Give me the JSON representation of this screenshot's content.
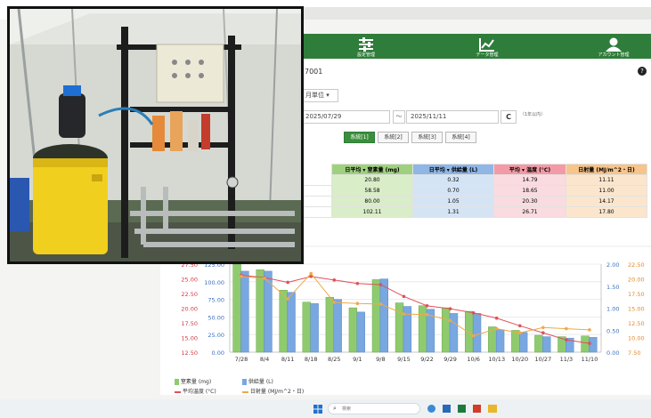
{
  "nav": {
    "items": [
      {
        "label": "設定管理",
        "icon": "sliders-icon"
      },
      {
        "label": "データ管理",
        "icon": "chart-icon"
      },
      {
        "label": "アカウント管理",
        "icon": "user-icon"
      }
    ]
  },
  "page": {
    "device_id": "7001",
    "help": "?",
    "dropdown_value": "月単位 ▾",
    "date_from": "2025/07/29",
    "date_sep": "～",
    "date_to": "2025/11/11",
    "refresh": "C",
    "note": "（1年以内）"
  },
  "tabs": [
    "系統[1]",
    "系統[2]",
    "系統[3]",
    "系統[4]"
  ],
  "table": {
    "headers": [
      "日平均 ▾ 窒素量 (mg)",
      "日平均 ▾ 供給量 (L)",
      "平均 ▾ 温度 (°C)",
      "日射量 (MJ/m^2・日)"
    ],
    "header_colors": [
      "#9fd07e",
      "#8eb6e6",
      "#f39aa6",
      "#f7c48a"
    ],
    "cell_colors": [
      "#d9edc8",
      "#d5e4f5",
      "#f9dbe0",
      "#fbe6cd"
    ],
    "rows": [
      [
        "20.80",
        "0.32",
        "14.79",
        "11.11"
      ],
      [
        "58.58",
        "0.70",
        "18.65",
        "11.00"
      ],
      [
        "80.00",
        "1.05",
        "20.30",
        "14.17"
      ],
      [
        "102.11",
        "1.31",
        "26.71",
        "17.80"
      ]
    ]
  },
  "legend": [
    {
      "label": "窒素量 (mg)",
      "color": "#8fcb6e"
    },
    {
      "label": "供給量 (L)",
      "color": "#79a7e0"
    },
    {
      "label": "平均温度 (°C)",
      "color": "#e0505a"
    },
    {
      "label": "日射量 (MJ/m^2・日)",
      "color": "#f0a848"
    }
  ],
  "taskbar": {
    "search": "検索"
  },
  "chart_data": {
    "type": "bar",
    "categories": [
      "7/28",
      "8/4",
      "8/11",
      "8/18",
      "8/25",
      "9/1",
      "9/8",
      "9/15",
      "9/22",
      "9/29",
      "10/6",
      "10/13",
      "10/20",
      "10/27",
      "11/3",
      "11/10"
    ],
    "series": [
      {
        "name": "窒素量 (mg)",
        "type": "bar",
        "axis": "left",
        "color": "#8fcb6e",
        "values": [
          125,
          117,
          88,
          71,
          78,
          63,
          103,
          70,
          66,
          63,
          58,
          36,
          31,
          24,
          22,
          23
        ]
      },
      {
        "name": "供給量 (L)",
        "type": "bar",
        "axis": "left",
        "color": "#79a7e0",
        "values": [
          115,
          115,
          85,
          69,
          75,
          57,
          104,
          65,
          61,
          55,
          55,
          32,
          28,
          22,
          20,
          21
        ]
      },
      {
        "name": "平均温度 (°C)",
        "type": "line",
        "axis": "far-right",
        "color": "#e0505a",
        "values": [
          20.6,
          20.2,
          19.4,
          20.4,
          19.8,
          19.2,
          19.0,
          17.0,
          15.4,
          14.9,
          14.2,
          13.3,
          12.0,
          10.8,
          9.6,
          9.0
        ]
      },
      {
        "name": "日射量 (MJ/m^2・日)",
        "type": "line",
        "axis": "far-right",
        "color": "#f0a848",
        "values": [
          20.4,
          20.1,
          16.6,
          20.9,
          16.0,
          15.8,
          15.7,
          14.0,
          13.9,
          12.9,
          10.3,
          11.5,
          10.8,
          11.7,
          11.5,
          11.3
        ]
      }
    ],
    "left_ticks": [
      "125.00",
      "100.00",
      "75.00",
      "50.00",
      "25.00",
      "0.00"
    ],
    "left_ylim": [
      0,
      125
    ],
    "red_ticks": [
      "27.50",
      "25.00",
      "22.50",
      "20.00",
      "17.50",
      "15.00",
      "12.50"
    ],
    "right_ticks": [
      "2.00",
      "1.50",
      "1.00",
      "0.50",
      "0.00"
    ],
    "right_ylim": [
      0,
      2
    ],
    "far_right_ticks": [
      "22.50",
      "20.00",
      "17.50",
      "15.00",
      "12.50",
      "10.00",
      "7.50"
    ],
    "far_right_ylim": [
      7.5,
      22.5
    ],
    "grid": true,
    "legend_position": "bottom-left"
  }
}
